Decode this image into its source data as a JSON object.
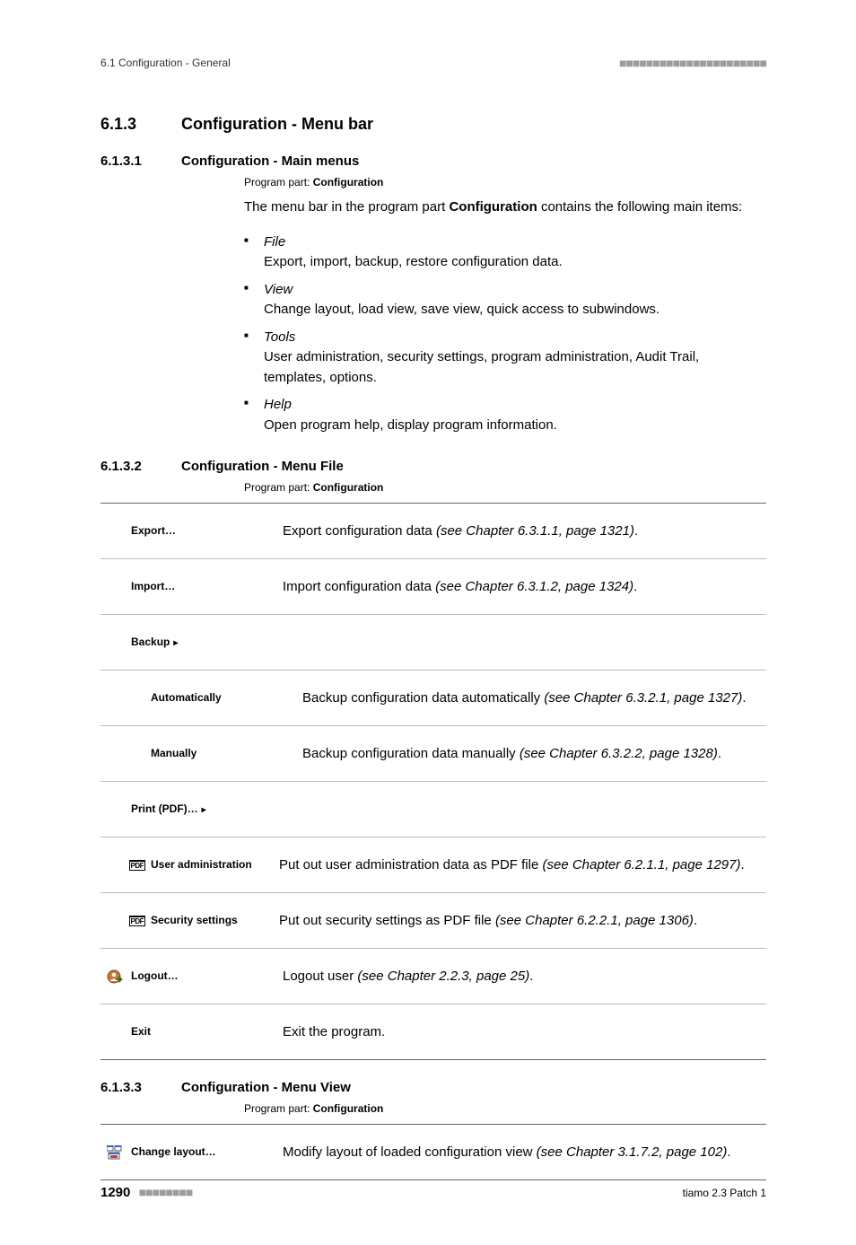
{
  "header": {
    "left": "6.1 Configuration - General",
    "dashes": "■■■■■■■■■■■■■■■■■■■■■■"
  },
  "section613": {
    "number": "6.1.3",
    "title": "Configuration - Menu bar"
  },
  "sec6131": {
    "number": "6.1.3.1",
    "title": "Configuration - Main menus",
    "program_part_label": "Program part:",
    "program_part_value": "Configuration",
    "intro_pre": "The menu bar in the program part ",
    "intro_bold": "Configuration",
    "intro_post": " contains the following main items:",
    "items": [
      {
        "name": "File",
        "desc": "Export, import, backup, restore configuration data."
      },
      {
        "name": "View",
        "desc": "Change layout, load view, save view, quick access to subwindows."
      },
      {
        "name": "Tools",
        "desc": "User administration, security settings, program administration, Audit Trail, templates, options."
      },
      {
        "name": "Help",
        "desc": "Open program help, display program information."
      }
    ]
  },
  "sec6132": {
    "number": "6.1.3.2",
    "title": "Configuration - Menu File",
    "program_part_label": "Program part:",
    "program_part_value": "Configuration",
    "rows": {
      "export": {
        "label": "Export…",
        "desc": "Export configuration data ",
        "ref": "(see Chapter 6.3.1.1, page 1321)",
        "tail": "."
      },
      "import": {
        "label": "Import…",
        "desc": "Import configuration data ",
        "ref": "(see Chapter 6.3.1.2, page 1324)",
        "tail": "."
      },
      "backup": {
        "label": "Backup"
      },
      "auto": {
        "label": "Automatically",
        "desc": "Backup configuration data automatically ",
        "ref": "(see Chapter 6.3.2.1, page 1327)",
        "tail": "."
      },
      "manual": {
        "label": "Manually",
        "desc": "Backup configuration data manually ",
        "ref": "(see Chapter 6.3.2.2, page 1328)",
        "tail": "."
      },
      "print": {
        "label": "Print (PDF)…"
      },
      "useradm": {
        "label": "User administra­tion",
        "desc": "Put out user administration data as PDF file ",
        "ref": "(see Chapter 6.2.1.1, page 1297)",
        "tail": "."
      },
      "secset": {
        "label": "Security settings",
        "desc": "Put out security settings as PDF file ",
        "ref": "(see Chapter 6.2.2.1, page 1306)",
        "tail": "."
      },
      "logout": {
        "label": "Logout…",
        "desc": "Logout user ",
        "ref": "(see Chapter 2.2.3, page 25)",
        "tail": "."
      },
      "exit": {
        "label": "Exit",
        "desc": "Exit the program."
      }
    },
    "pdf_icon_text": "PDF"
  },
  "sec6133": {
    "number": "6.1.3.3",
    "title": "Configuration - Menu View",
    "program_part_label": "Program part:",
    "program_part_value": "Configuration",
    "rows": {
      "changelayout": {
        "label": "Change layout…",
        "desc": "Modify layout of loaded configuration view ",
        "ref": "(see Chapter 3.1.7.2, page 102)",
        "tail": "."
      }
    }
  },
  "footer": {
    "page": "1290",
    "dashes": "■■■■■■■■",
    "product": "tiamo 2.3 Patch 1"
  }
}
